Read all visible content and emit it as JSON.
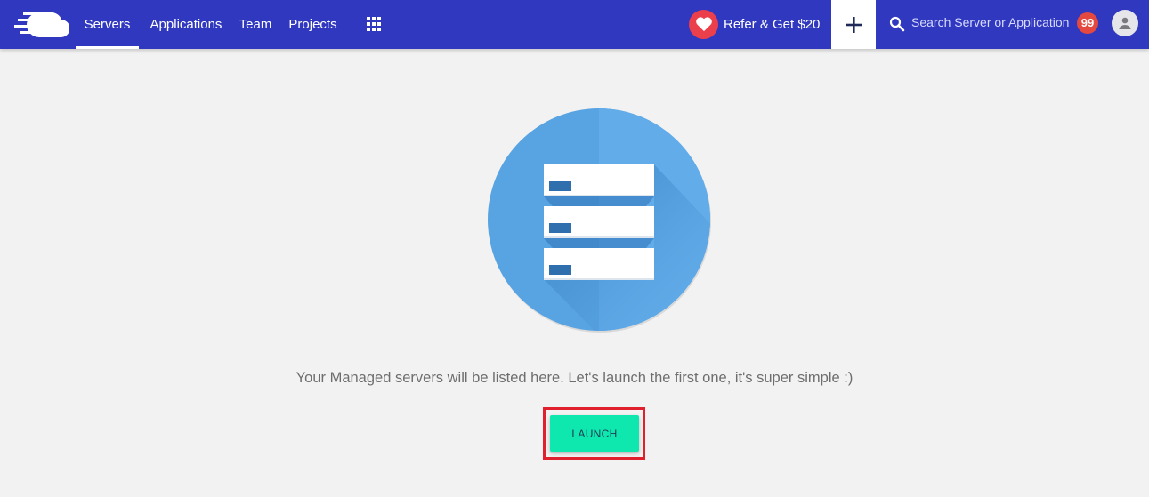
{
  "topbar": {
    "brand_color": "#3038bf",
    "logo_icon": "cloud-speed-icon",
    "nav": [
      {
        "label": "Servers",
        "active": true
      },
      {
        "label": "Applications",
        "active": false
      },
      {
        "label": "Team",
        "active": false
      },
      {
        "label": "Projects",
        "active": false
      }
    ],
    "apps_icon": "grid-icon",
    "refer": {
      "label": "Refer & Get $20",
      "icon": "heart-icon"
    },
    "add_icon": "plus-icon",
    "search": {
      "placeholder": "Search Server or Application",
      "value": "",
      "icon": "search-icon"
    },
    "notifications": {
      "count": "99"
    },
    "avatar_icon": "user-icon"
  },
  "main": {
    "illustration": "server-stack-illustration",
    "empty_message": "Your Managed servers will be listed here. Let's launch the first one, it's super simple :)",
    "launch_label": "LAUNCH",
    "launch_color": "#0ee8ae",
    "highlight_color": "#e0202c"
  }
}
